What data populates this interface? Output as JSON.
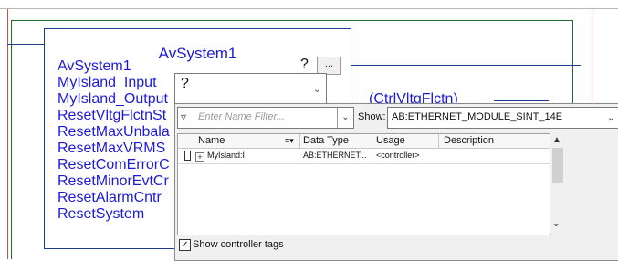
{
  "block": {
    "title": "AvSystem1",
    "pins": [
      "AvSystem1",
      "MyIsland_Input",
      "MyIsland_Output",
      "ResetVltgFlctnSt",
      "ResetMaxUnbala",
      "ResetMaxVRMS",
      "ResetComErrorC",
      "ResetMinorEvtCr",
      "ResetAlarmCntr",
      "ResetSystem"
    ],
    "question_mark": "?",
    "ellipsis_label": "...",
    "operand_value": "?",
    "output_tag_label": "CtrlVltgFlctn"
  },
  "tag_browser": {
    "filter_placeholder": "Enter Name Filter...",
    "show_label": "Show:",
    "show_value": "AB:ETHERNET_MODULE_SINT_14E",
    "columns": [
      "Name",
      "Data Type",
      "Usage",
      "Description"
    ],
    "rows": [
      {
        "name": "MyIsland:I",
        "data_type": "AB:ETHERNET...",
        "usage": "<controller>",
        "description": ""
      }
    ],
    "show_controller_tags_label": "Show controller tags",
    "show_controller_tags_checked": true
  },
  "colors": {
    "block_text": "#1c1cd8",
    "block_border": "#1e3a8a",
    "rung_green": "#1f6f2a",
    "rail_red": "#d94a4a",
    "rail_blue": "#1e3a8a"
  }
}
